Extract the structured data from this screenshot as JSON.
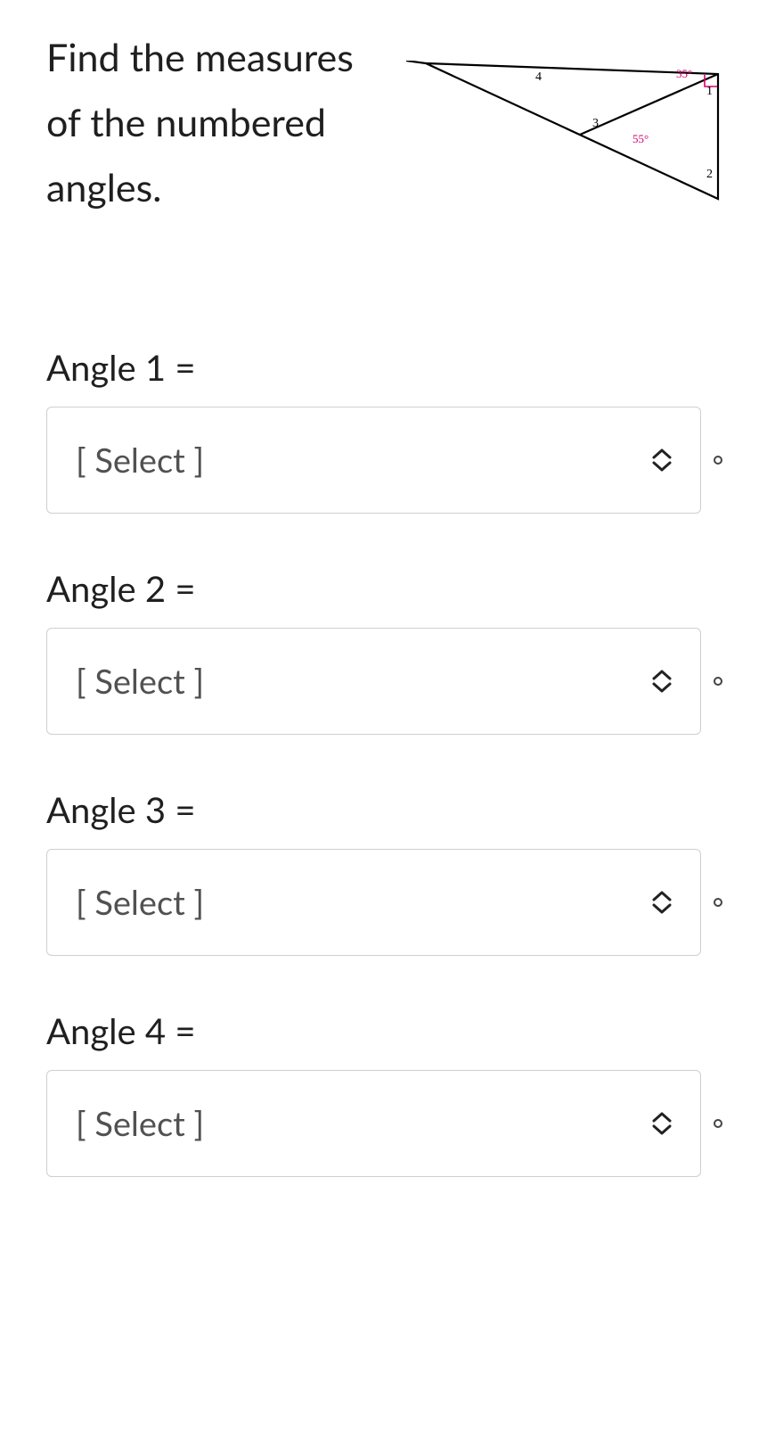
{
  "question": "Find the measures of the numbered angles.",
  "figure": {
    "angle_top_right": "35°",
    "angle_middle": "55°",
    "label_1": "1",
    "label_2": "2",
    "label_3": "3",
    "label_4": "4"
  },
  "answers": [
    {
      "label": "Angle 1 =",
      "placeholder": "[ Select ]"
    },
    {
      "label": "Angle 2 =",
      "placeholder": "[ Select ]"
    },
    {
      "label": "Angle 3 =",
      "placeholder": "[ Select ]"
    },
    {
      "label": "Angle 4 =",
      "placeholder": "[ Select ]"
    }
  ]
}
